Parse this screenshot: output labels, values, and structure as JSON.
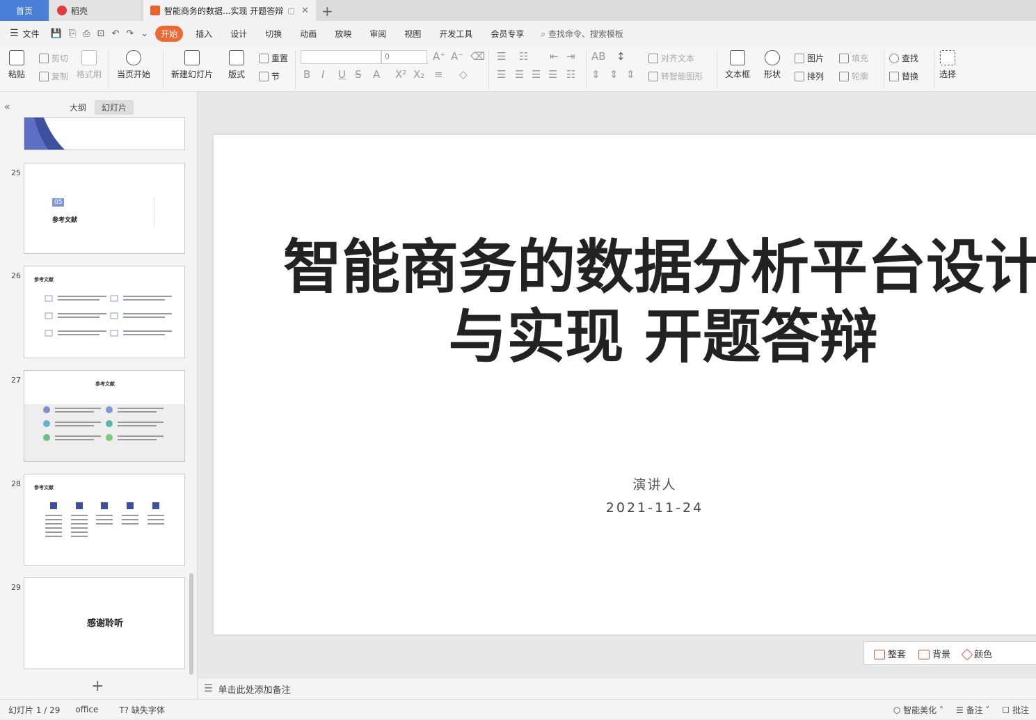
{
  "tabs": {
    "home": "首页",
    "daoke": "稻壳",
    "doc": "智能商务的数据...实现 开题答辩",
    "add": "+"
  },
  "menubar": {
    "file": "文件",
    "tabs": [
      "开始",
      "插入",
      "设计",
      "切换",
      "动画",
      "放映",
      "审阅",
      "视图",
      "开发工具",
      "会员专享"
    ],
    "search_placeholder": "查找命令、搜索模板"
  },
  "ribbon": {
    "paste": "粘贴",
    "cut": "剪切",
    "copy": "复制",
    "format_painter": "格式刷",
    "start_from_current": "当页开始",
    "new_slide": "新建幻灯片",
    "layout": "版式",
    "reset": "重置",
    "section": "节",
    "font_size": "0",
    "align_text": "对齐文本",
    "convert_smartart": "转智能图形",
    "textbox": "文本框",
    "shape": "形状",
    "picture": "图片",
    "arrange": "排列",
    "fill": "填充",
    "outline": "轮廓",
    "find": "查找",
    "replace": "替换",
    "select": "选择"
  },
  "sidebar": {
    "outline_tab": "大纲",
    "slides_tab": "幻灯片",
    "thumbs": [
      {
        "num": "25",
        "badge": "05",
        "title": "参考文献"
      },
      {
        "num": "26",
        "title": "参考文献"
      },
      {
        "num": "27",
        "title": "参考文献"
      },
      {
        "num": "28",
        "title": "参考文献"
      },
      {
        "num": "29",
        "title": "感谢聆听"
      }
    ]
  },
  "slide": {
    "title_line1": "智能商务的数据分析平台设计",
    "title_line2": "与实现 开题答辩",
    "speaker": "演讲人",
    "date": "2021-11-24"
  },
  "beautify": {
    "suite": "整套",
    "background": "背景",
    "color": "颜色"
  },
  "notes": {
    "placeholder": "单击此处添加备注"
  },
  "status": {
    "slide_pos": "幻灯片 1 / 29",
    "theme": "office",
    "missing_font": "缺失字体",
    "smart_beautify": "智能美化",
    "notes_btn": "备注",
    "comment_btn": "批注"
  },
  "colors": {
    "accent": "#ee6a32",
    "home_tab": "#4a7fd8"
  }
}
